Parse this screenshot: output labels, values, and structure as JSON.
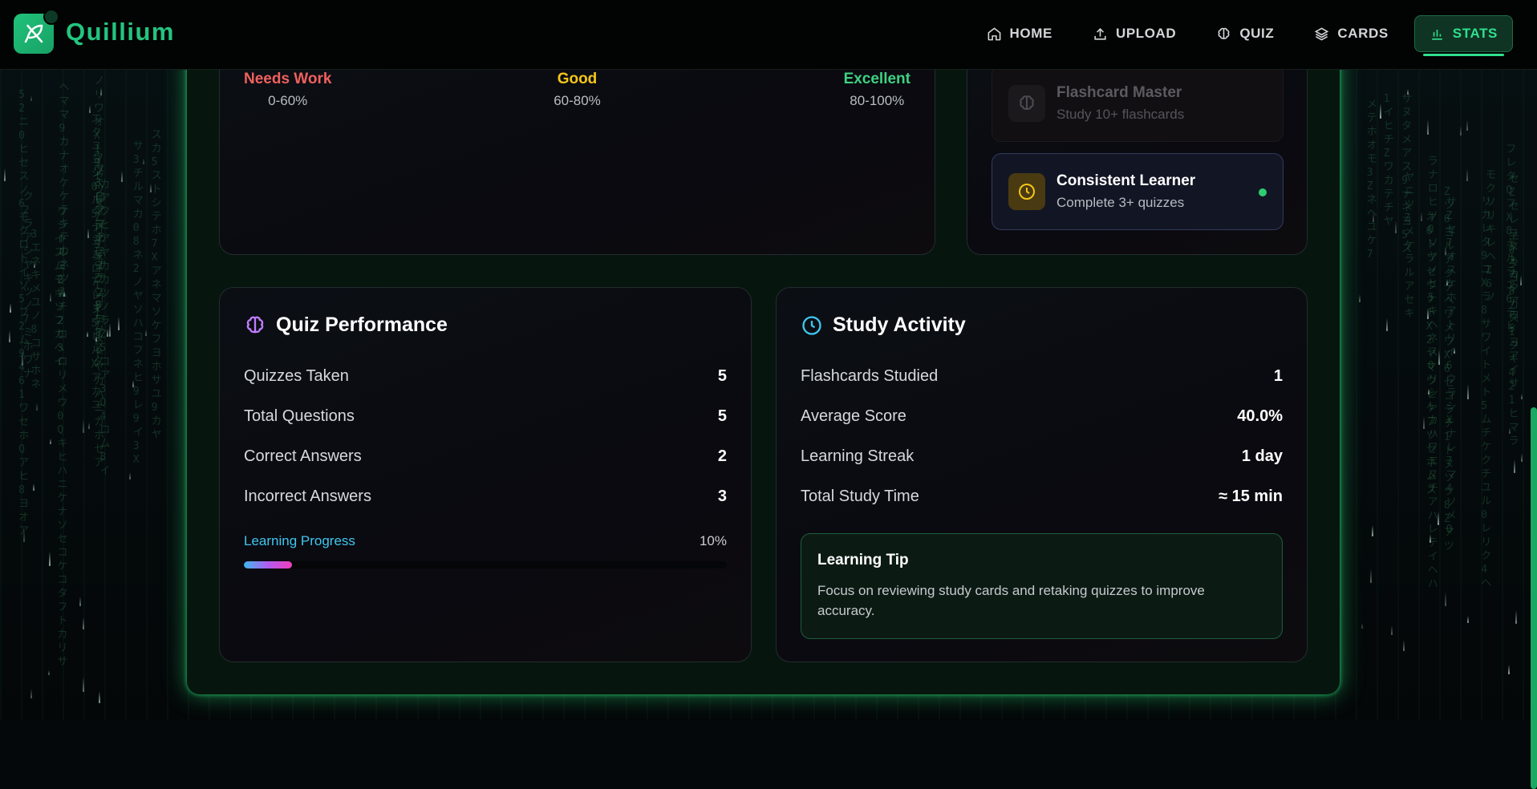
{
  "app": {
    "name": "Quillium"
  },
  "nav": {
    "items": [
      {
        "label": "HOME",
        "icon": "home-icon",
        "active": false
      },
      {
        "label": "UPLOAD",
        "icon": "upload-icon",
        "active": false
      },
      {
        "label": "QUIZ",
        "icon": "brain-icon",
        "active": false
      },
      {
        "label": "CARDS",
        "icon": "layers-icon",
        "active": false
      },
      {
        "label": "STATS",
        "icon": "bar-chart-icon",
        "active": true
      }
    ]
  },
  "score_legend": {
    "items": [
      {
        "label": "Needs Work",
        "range": "0-60%",
        "color": "#f0605e"
      },
      {
        "label": "Good",
        "range": "60-80%",
        "color": "#f5c518"
      },
      {
        "label": "Excellent",
        "range": "80-100%",
        "color": "#3ed180"
      }
    ]
  },
  "achievements": {
    "items": [
      {
        "title": "Flashcard Master",
        "description": "Study 10+ flashcards",
        "unlocked": false,
        "icon": "brain-icon"
      },
      {
        "title": "Consistent Learner",
        "description": "Complete 3+ quizzes",
        "unlocked": true,
        "icon": "clock-icon"
      }
    ]
  },
  "quiz_performance": {
    "title": "Quiz Performance",
    "rows": [
      {
        "label": "Quizzes Taken",
        "value": "5"
      },
      {
        "label": "Total Questions",
        "value": "5"
      },
      {
        "label": "Correct Answers",
        "value": "2"
      },
      {
        "label": "Incorrect Answers",
        "value": "3"
      }
    ],
    "progress": {
      "label": "Learning Progress",
      "value_text": "10%",
      "fraction": 0.1
    }
  },
  "study_activity": {
    "title": "Study Activity",
    "rows": [
      {
        "label": "Flashcards Studied",
        "value": "1"
      },
      {
        "label": "Average Score",
        "value": "40.0%"
      },
      {
        "label": "Learning Streak",
        "value": "1 day"
      },
      {
        "label": "Total Study Time",
        "value": "≈ 15 min"
      }
    ],
    "tip": {
      "title": "Learning Tip",
      "body": "Focus on reviewing study cards and retaking quizzes to improve accuracy."
    }
  },
  "colors": {
    "brand": "#24c47f",
    "accent_active": "#2fe08e",
    "progress_gradient": [
      "#3fb8f0",
      "#b05cf0",
      "#ee3fb8"
    ],
    "quiz_icon": "#c07cff",
    "study_icon": "#3fc7ef",
    "achievement_dot": "#2ecc71"
  }
}
